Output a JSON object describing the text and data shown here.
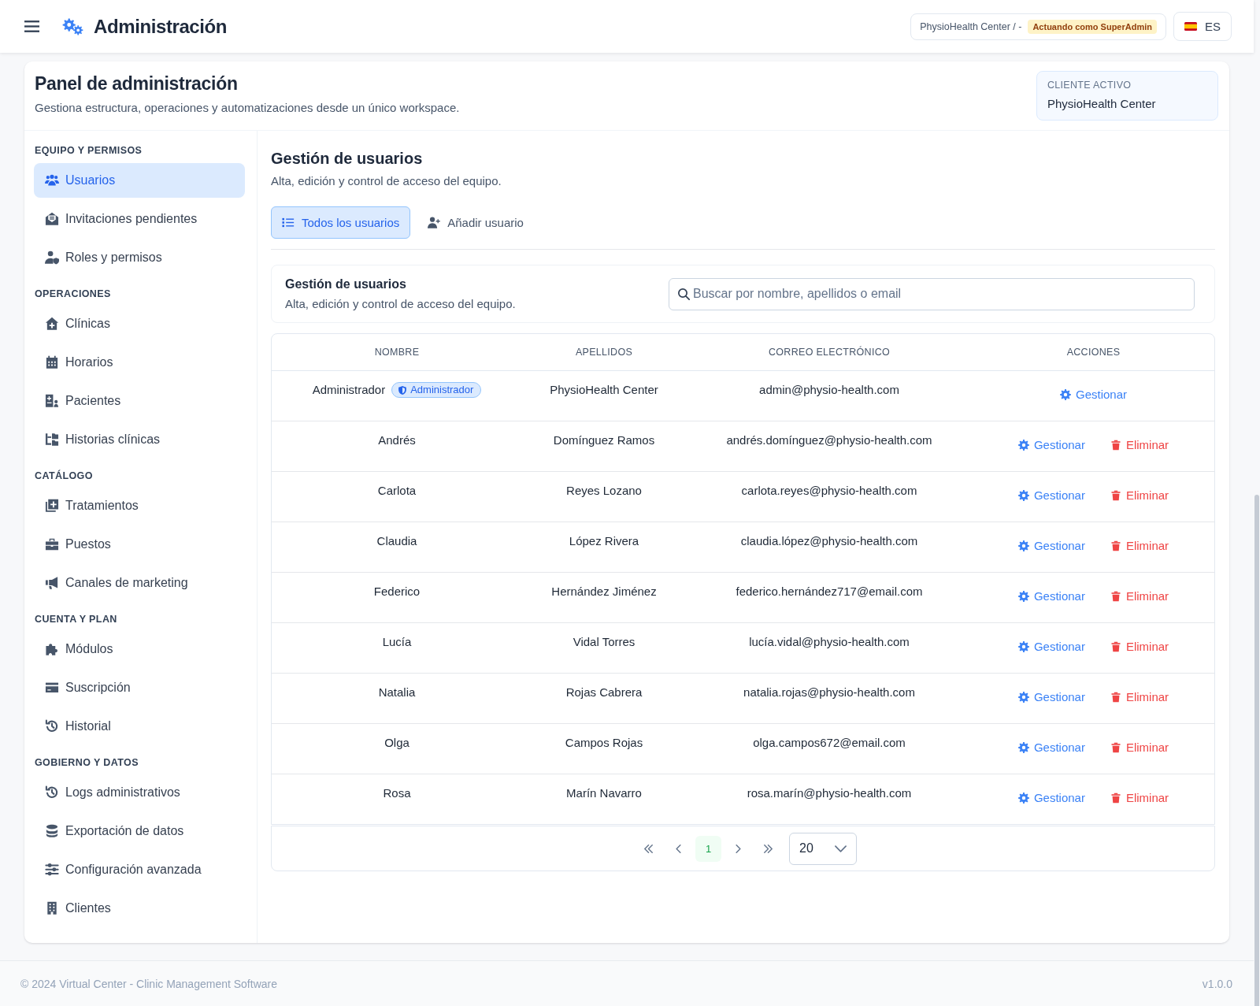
{
  "top_bar": {
    "title": "Administración",
    "context": {
      "label": "PhysioHealth Center / -",
      "badge": "Actuando como SuperAdmin"
    },
    "language": "ES"
  },
  "panel": {
    "title": "Panel de administración",
    "subtitle": "Gestiona estructura, operaciones y automatizaciones desde un único workspace.",
    "active_client": {
      "label": "CLIENTE ACTIVO",
      "name": "PhysioHealth Center"
    }
  },
  "sidebar": {
    "sections": [
      {
        "title": "EQUIPO Y PERMISOS",
        "items": [
          {
            "label": "Usuarios",
            "selected": true
          },
          {
            "label": "Invitaciones pendientes",
            "selected": false
          },
          {
            "label": "Roles y permisos",
            "selected": false
          }
        ]
      },
      {
        "title": "OPERACIONES",
        "items": [
          {
            "label": "Clínicas",
            "selected": false
          },
          {
            "label": "Horarios",
            "selected": false
          },
          {
            "label": "Pacientes",
            "selected": false
          },
          {
            "label": "Historias clínicas",
            "selected": false
          }
        ]
      },
      {
        "title": "CATÁLOGO",
        "items": [
          {
            "label": "Tratamientos",
            "selected": false
          },
          {
            "label": "Puestos",
            "selected": false
          },
          {
            "label": "Canales de marketing",
            "selected": false
          }
        ]
      },
      {
        "title": "CUENTA Y PLAN",
        "items": [
          {
            "label": "Módulos",
            "selected": false
          },
          {
            "label": "Suscripción",
            "selected": false
          },
          {
            "label": "Historial",
            "selected": false
          }
        ]
      },
      {
        "title": "GOBIERNO Y DATOS",
        "items": [
          {
            "label": "Logs administrativos",
            "selected": false
          },
          {
            "label": "Exportación de datos",
            "selected": false
          },
          {
            "label": "Configuración avanzada",
            "selected": false
          },
          {
            "label": "Clientes",
            "selected": false
          }
        ]
      }
    ]
  },
  "content": {
    "title": "Gestión de usuarios",
    "subtitle": "Alta, edición y control de acceso del equipo.",
    "tabs": [
      {
        "label": "Todos los usuarios",
        "selected": true
      },
      {
        "label": "Añadir usuario",
        "selected": false
      }
    ]
  },
  "users_card": {
    "title": "Gestión de usuarios",
    "subtitle": "Alta, edición y control de acceso del equipo.",
    "search": {
      "placeholder": "Buscar por nombre, apellidos o email"
    }
  },
  "table": {
    "columns": [
      "NOMBRE",
      "APELLIDOS",
      "CORREO ELECTRÓNICO",
      "ACCIONES"
    ],
    "rows": [
      {
        "name": "Administrador",
        "badge": "Administrador",
        "surname": "PhysioHealth Center",
        "email": "admin@physio-health.com",
        "actions": [
          {
            "kind": "manage",
            "label": "Gestionar"
          }
        ]
      },
      {
        "name": "Andrés",
        "surname": "Domínguez Ramos",
        "email": "andrés.domínguez@physio-health.com",
        "actions": [
          {
            "kind": "manage",
            "label": "Gestionar"
          },
          {
            "kind": "delete",
            "label": "Eliminar"
          }
        ]
      },
      {
        "name": "Carlota",
        "surname": "Reyes Lozano",
        "email": "carlota.reyes@physio-health.com",
        "actions": [
          {
            "kind": "manage",
            "label": "Gestionar"
          },
          {
            "kind": "delete",
            "label": "Eliminar"
          }
        ]
      },
      {
        "name": "Claudia",
        "surname": "López Rivera",
        "email": "claudia.lópez@physio-health.com",
        "actions": [
          {
            "kind": "manage",
            "label": "Gestionar"
          },
          {
            "kind": "delete",
            "label": "Eliminar"
          }
        ]
      },
      {
        "name": "Federico",
        "surname": "Hernández Jiménez",
        "email": "federico.hernández717@email.com",
        "actions": [
          {
            "kind": "manage",
            "label": "Gestionar"
          },
          {
            "kind": "delete",
            "label": "Eliminar"
          }
        ]
      },
      {
        "name": "Lucía",
        "surname": "Vidal Torres",
        "email": "lucía.vidal@physio-health.com",
        "actions": [
          {
            "kind": "manage",
            "label": "Gestionar"
          },
          {
            "kind": "delete",
            "label": "Eliminar"
          }
        ]
      },
      {
        "name": "Natalia",
        "surname": "Rojas Cabrera",
        "email": "natalia.rojas@physio-health.com",
        "actions": [
          {
            "kind": "manage",
            "label": "Gestionar"
          },
          {
            "kind": "delete",
            "label": "Eliminar"
          }
        ]
      },
      {
        "name": "Olga",
        "surname": "Campos Rojas",
        "email": "olga.campos672@email.com",
        "actions": [
          {
            "kind": "manage",
            "label": "Gestionar"
          },
          {
            "kind": "delete",
            "label": "Eliminar"
          }
        ]
      },
      {
        "name": "Rosa",
        "surname": "Marín Navarro",
        "email": "rosa.marín@physio-health.com",
        "actions": [
          {
            "kind": "manage",
            "label": "Gestionar"
          },
          {
            "kind": "delete",
            "label": "Eliminar"
          }
        ]
      }
    ]
  },
  "pagination": {
    "pages": [
      {
        "label": "1",
        "selected": true
      }
    ],
    "page_size": "20"
  },
  "footer": {
    "copyright": "© 2024 Virtual Center - Clinic Management Software",
    "version": "v1.0.0"
  }
}
